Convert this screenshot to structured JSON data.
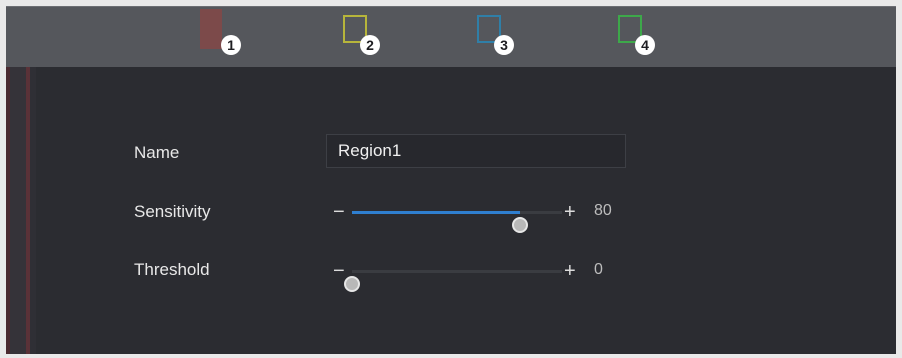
{
  "regions": [
    {
      "number": "1",
      "color": "#7c4a4a"
    },
    {
      "number": "2",
      "color": "#b7b53b"
    },
    {
      "number": "3",
      "color": "#2f7fa8"
    },
    {
      "number": "4",
      "color": "#3da84a"
    }
  ],
  "form": {
    "name_label": "Name",
    "name_value": "Region1",
    "sensitivity_label": "Sensitivity",
    "sensitivity_value": "80",
    "sensitivity_fraction": 0.8,
    "threshold_label": "Threshold",
    "threshold_value": "0",
    "threshold_fraction": 0.0,
    "minus_glyph": "−",
    "plus_glyph": "+"
  },
  "colors": {
    "slider_fill": "#2f7fd0"
  }
}
